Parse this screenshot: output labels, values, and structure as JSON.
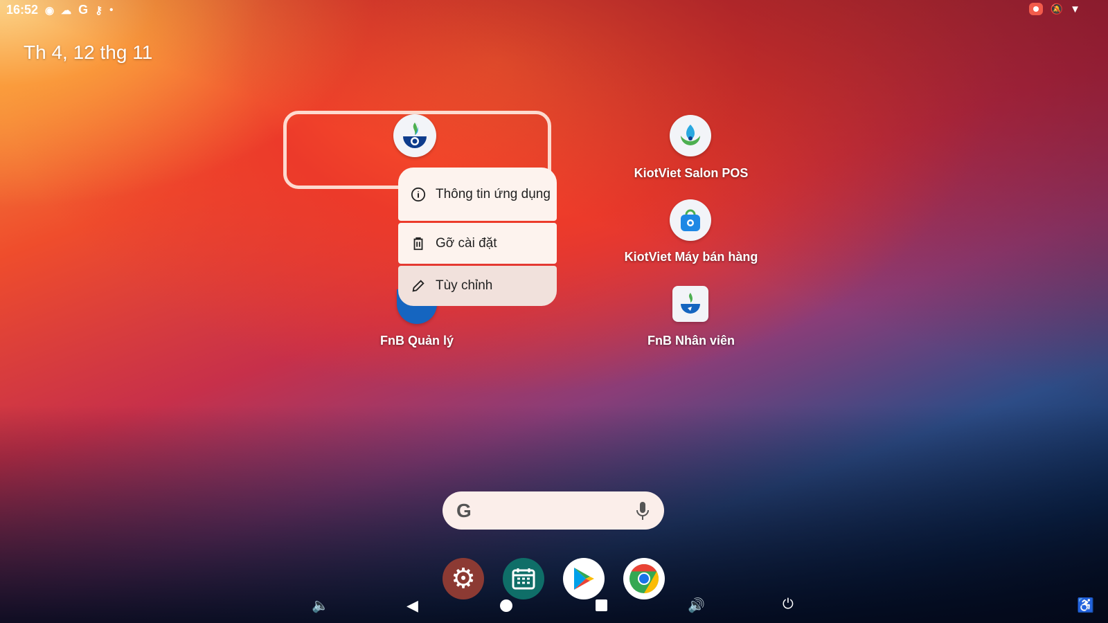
{
  "status_bar": {
    "time": "16:52",
    "icons": [
      "screen-record-icon",
      "cloud-icon",
      "google-icon",
      "key-icon",
      "dot-icon"
    ],
    "right_icons": [
      "recording-icon",
      "bell-off-icon",
      "wifi-icon"
    ]
  },
  "date": "Th 4, 12 thg 11",
  "context_menu": {
    "items": [
      {
        "label": "Thông tin ứng dụng",
        "icon": "info-icon"
      },
      {
        "label": "Gỡ cài đặt",
        "icon": "trash-icon"
      },
      {
        "label": "Tùy chỉnh",
        "icon": "pencil-icon"
      }
    ]
  },
  "apps": [
    {
      "label": "KiotViet Salon POS"
    },
    {
      "label": "KiotViet Máy bán hàng"
    },
    {
      "label": "FnB Quản lý"
    },
    {
      "label": "FnB Nhân viên"
    }
  ],
  "search": {
    "logo": "G"
  },
  "dock": [
    "settings",
    "calendar",
    "play-store",
    "chrome"
  ],
  "colors": {
    "menu_bg": "#fdf3ee",
    "accent_blue": "#1565c0"
  }
}
